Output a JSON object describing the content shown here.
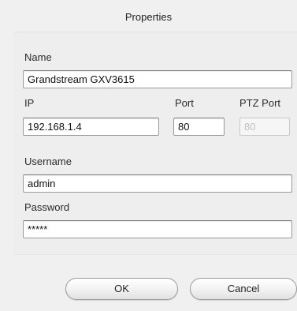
{
  "window": {
    "title": "Properties"
  },
  "form": {
    "name": {
      "label": "Name",
      "value": "Grandstream GXV3615"
    },
    "ip": {
      "label": "IP",
      "value": "192.168.1.4"
    },
    "port": {
      "label": "Port",
      "value": "80"
    },
    "ptz_port": {
      "label": "PTZ Port",
      "value": "80"
    },
    "username": {
      "label": "Username",
      "value": "admin"
    },
    "password": {
      "label": "Password",
      "value": "*****"
    }
  },
  "buttons": {
    "ok_label": "OK",
    "cancel_label": "Cancel"
  }
}
